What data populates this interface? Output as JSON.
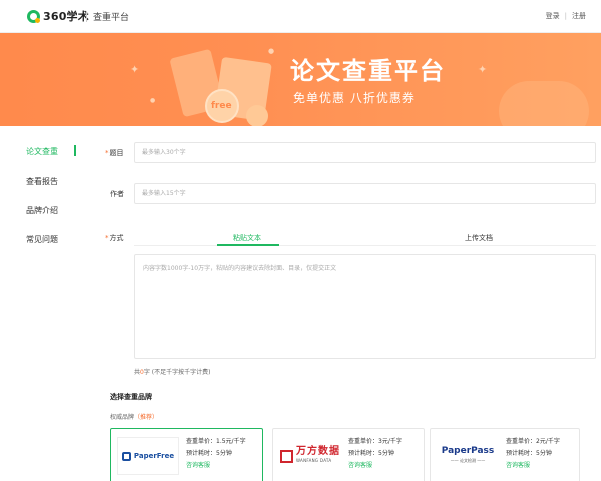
{
  "header": {
    "logo_text": "360学术",
    "platform_name": "查重平台",
    "login": "登录",
    "separator": "|",
    "register": "注册"
  },
  "banner": {
    "title": "论文查重平台",
    "subtitle": "免单优惠  八折优惠券",
    "coin_label": "free"
  },
  "sidebar": {
    "items": [
      {
        "label": "论文查重"
      },
      {
        "label": "查看报告"
      },
      {
        "label": "品牌介绍"
      },
      {
        "label": "常见问题"
      }
    ]
  },
  "form": {
    "title_label": "题目",
    "title_placeholder": "最多输入30个字",
    "author_label": "作者",
    "author_placeholder": "最多输入15个字",
    "method_label": "方式",
    "required_mark": "*",
    "tabs": [
      {
        "label": "粘贴文本"
      },
      {
        "label": "上传文档"
      }
    ],
    "textarea_placeholder": "内容字数1000字-10万字，粘贴的内容建议去除封面、目录，仅提交正文",
    "wordcount_prefix": "共",
    "wordcount_value": "0",
    "wordcount_suffix": "字 (不足千字按千字计费)"
  },
  "brands": {
    "section_title": "选择查重品牌",
    "group_label": "权威品牌",
    "recommend": "（推荐）",
    "cards": [
      {
        "logo": "PaperFree",
        "price": "查重单价：1.5元/千字",
        "time": "预计耗时：5分钟",
        "consult": "咨询客服"
      },
      {
        "logo_cn": "万方数据",
        "logo_en": "WANFANG DATA",
        "price": "查重单价：3元/千字",
        "time": "预计耗时：5分钟",
        "consult": "咨询客服"
      },
      {
        "logo_en": "PaperPass",
        "logo_cn": "—— 论文检测 ——",
        "price": "查重单价：2元/千字",
        "time": "预计耗时：5分钟",
        "consult": "咨询客服"
      }
    ]
  },
  "colors": {
    "accent": "#1fb860",
    "banner": "#ff8a4c",
    "required": "#f56c2d"
  }
}
